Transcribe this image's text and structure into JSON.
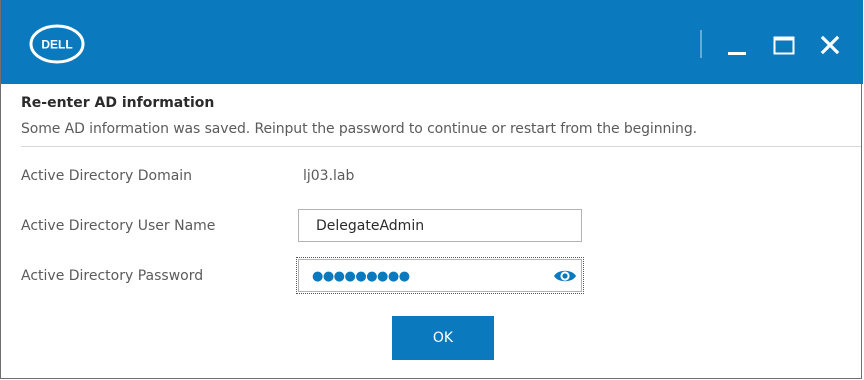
{
  "titlebar": {
    "logo_text": "DELL",
    "controls": {
      "minimize_icon": "minimize-icon",
      "maximize_icon": "maximize-icon",
      "close_icon": "close-icon"
    }
  },
  "dialog": {
    "heading": "Re-enter AD information",
    "message": "Some AD information was saved. Reinput the password to continue or restart from the beginning."
  },
  "form": {
    "domain_label": "Active Directory Domain",
    "domain_value": "lj03.lab",
    "username_label": "Active Directory User Name",
    "username_value": "DelegateAdmin",
    "password_label": "Active Directory Password",
    "password_masked": "●●●●●●●●●",
    "password_toggle_icon": "eye-icon"
  },
  "actions": {
    "ok_label": "OK"
  },
  "colors": {
    "accent": "#0a79bd",
    "text": "#5b5b5b",
    "heading": "#2b2b2b"
  }
}
